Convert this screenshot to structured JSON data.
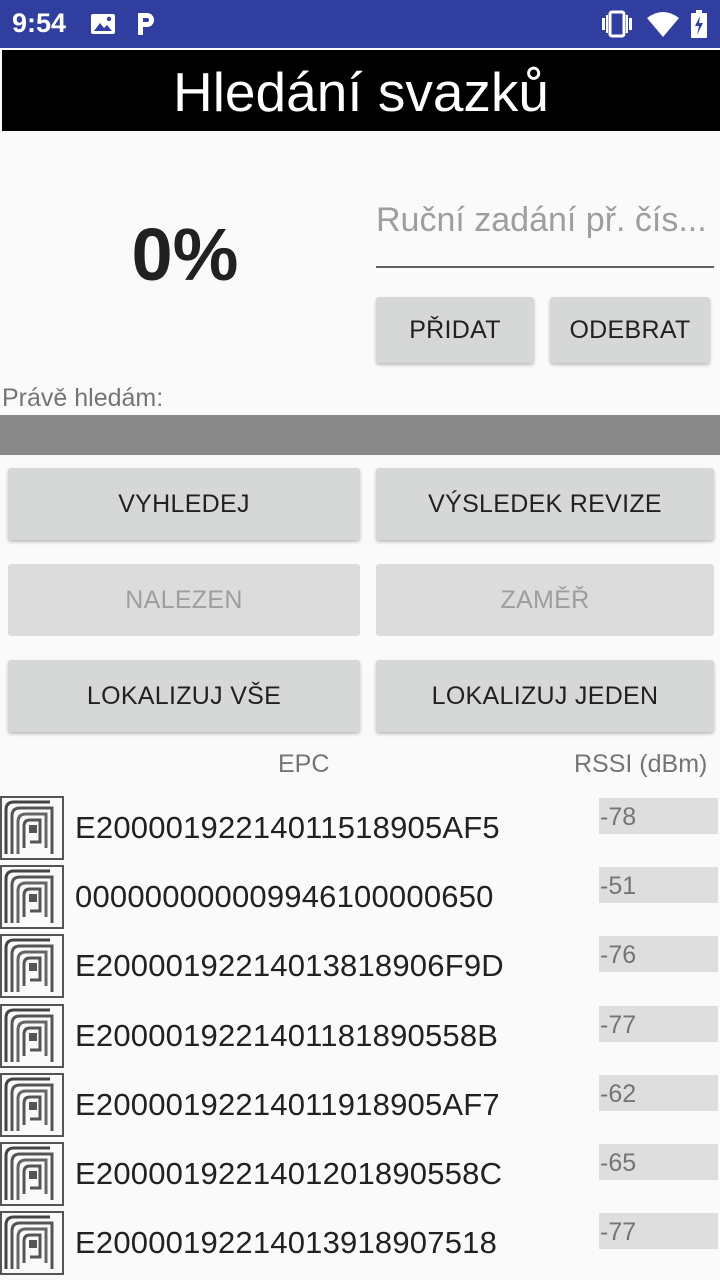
{
  "status_bar": {
    "time": "9:54",
    "icons": [
      "image-icon",
      "parking-icon",
      "vibrate-icon",
      "wifi-icon",
      "battery-charging-icon"
    ]
  },
  "title": "Hledání svazků",
  "progress": {
    "percent_text": "0%",
    "value": 0
  },
  "manual_input": {
    "placeholder": "Ruční zadání př. čís...",
    "value": ""
  },
  "buttons": {
    "add": "PŘIDAT",
    "remove": "ODEBRAT",
    "search": "VYHLEDEJ",
    "revision_result": "VÝSLEDEK REVIZE",
    "found": "NALEZEN",
    "intent": "ZAMĚŘ",
    "locate_all": "LOKALIZUJ VŠE",
    "locate_one": "LOKALIZUJ JEDEN"
  },
  "current_search": {
    "label": "Právě hledám:",
    "value": ""
  },
  "table": {
    "headers": {
      "epc": "EPC",
      "rssi": "RSSI (dBm)"
    },
    "rows": [
      {
        "epc": "E2000019221401151890​5AF5",
        "rssi": "-78"
      },
      {
        "epc": "000000000009946100000650",
        "rssi": "-51"
      },
      {
        "epc": "E20000192214013818906F9D",
        "rssi": "-76"
      },
      {
        "epc": "E2000019221401181890558B",
        "rssi": "-77"
      },
      {
        "epc": "E20000192214011918905AF7",
        "rssi": "-62"
      },
      {
        "epc": "E2000019221401201890558C",
        "rssi": "-65"
      },
      {
        "epc": "E20000192214013918907518",
        "rssi": "-77"
      }
    ]
  },
  "colors": {
    "status_bar": "#303f9f",
    "title_bar": "#000000",
    "button": "#d6d7d7",
    "search_bar": "#898989"
  }
}
